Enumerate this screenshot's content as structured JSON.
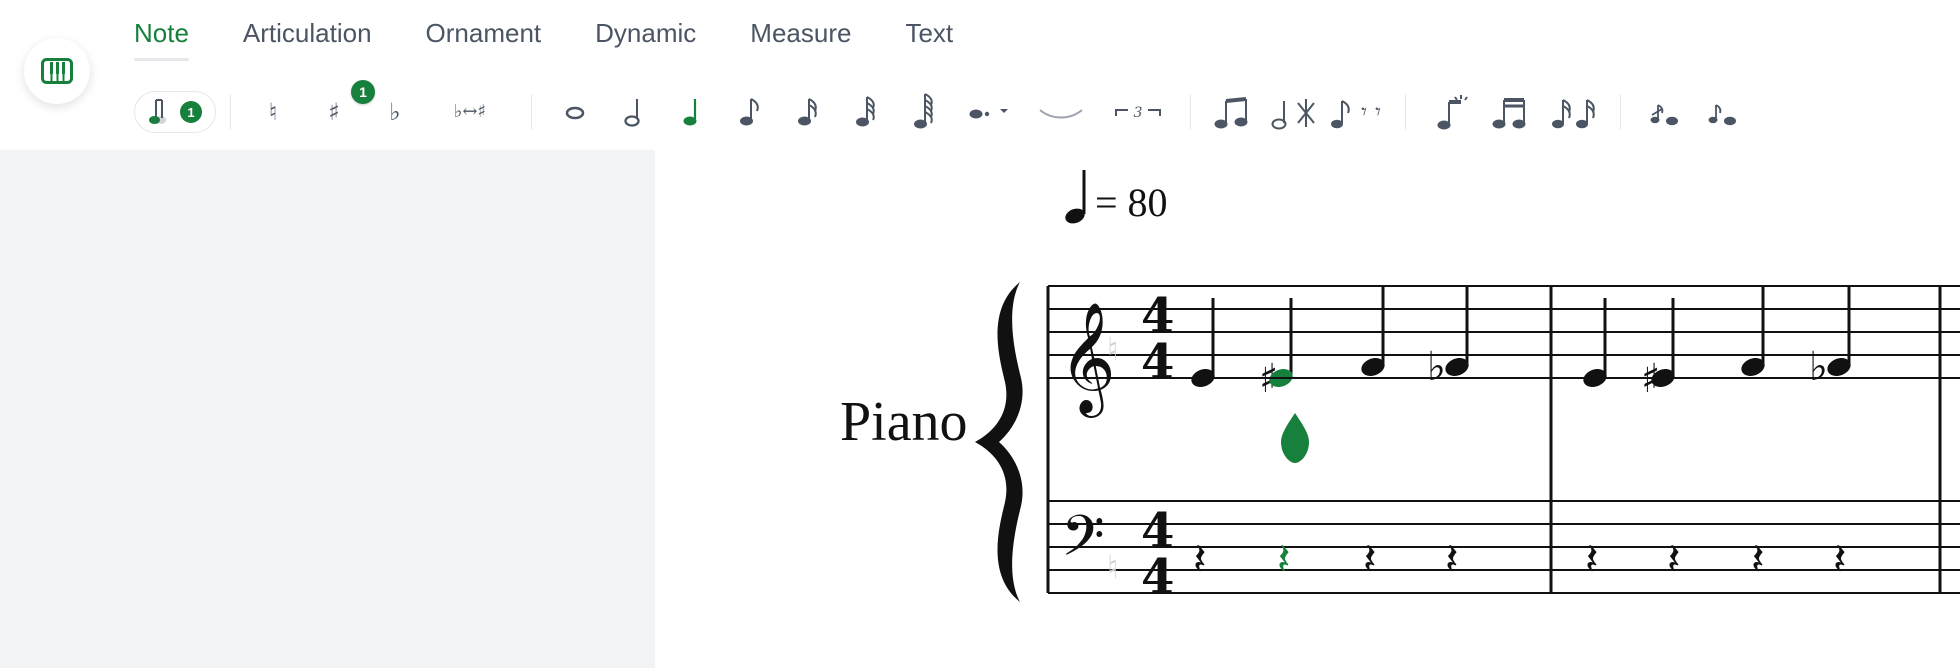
{
  "header": {
    "tabs": [
      {
        "label": "Note",
        "active": true
      },
      {
        "label": "Articulation",
        "active": false
      },
      {
        "label": "Ornament",
        "active": false
      },
      {
        "label": "Dynamic",
        "active": false
      },
      {
        "label": "Measure",
        "active": false
      },
      {
        "label": "Text",
        "active": false
      }
    ]
  },
  "toolbar": {
    "selection_count": "1",
    "sharp_badge": "1",
    "groups": [
      "pitch-and-accidentals",
      "durations",
      "dots-and-ties",
      "beams",
      "grace-notes"
    ]
  },
  "score": {
    "tempo_value": "= 80",
    "instrument": "Piano",
    "time_signature": {
      "top": "4",
      "bottom": "4"
    }
  },
  "colors": {
    "accent": "#17803d",
    "text": "#111111",
    "muted": "#4b5563",
    "panel": "#f2f3f4"
  },
  "icons": {
    "app": "piano-keyboard-icon",
    "natural": "natural-icon",
    "sharp": "sharp-icon",
    "flat": "flat-icon",
    "enharmonic": "flat-sharp-swap-icon",
    "whole": "whole-note-icon",
    "half": "half-note-icon",
    "quarter": "quarter-note-icon",
    "eighth": "eighth-note-icon",
    "sixteenth": "sixteenth-note-icon",
    "thirtysecond": "thirtysecond-note-icon",
    "sixtyfourth": "sixtyfourth-note-icon",
    "dot": "dotted-note-icon",
    "tie": "tie-icon",
    "tuplet": "triplet-icon",
    "beam": "beam-icon",
    "flip": "flip-stem-icon",
    "rests": "rest-icon",
    "grace": "grace-note-icon"
  }
}
